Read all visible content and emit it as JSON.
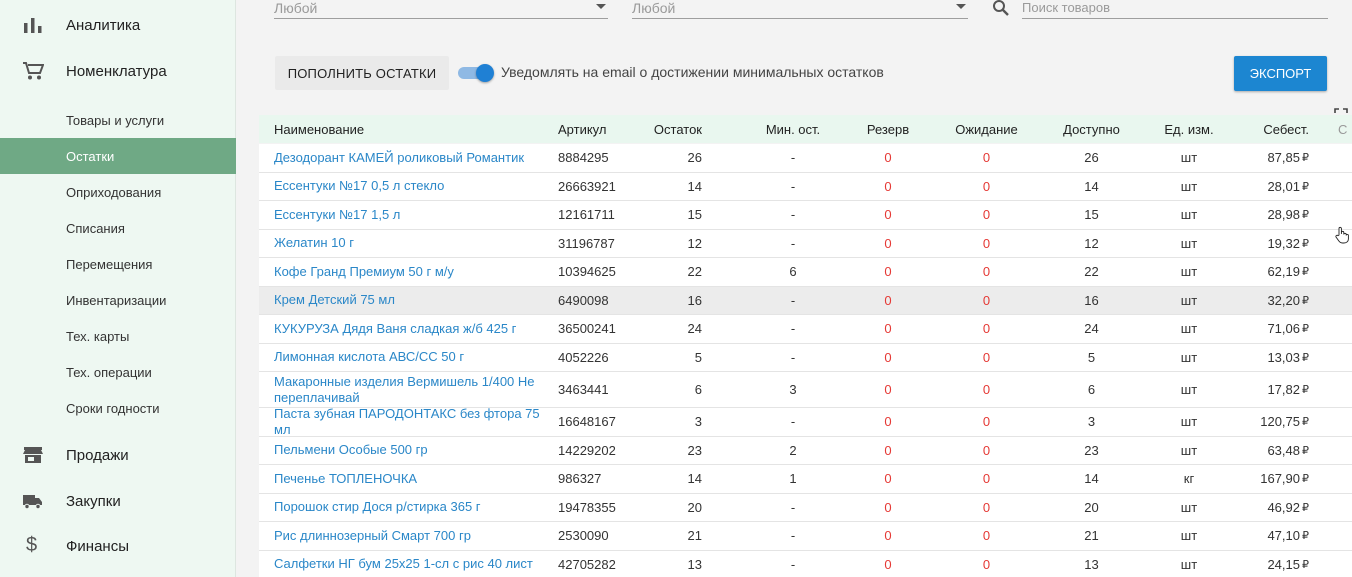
{
  "sidebar": {
    "main_items": [
      {
        "label": "Аналитика",
        "icon": "bar-chart-icon"
      },
      {
        "label": "Номенклатура",
        "icon": "cart-icon"
      },
      {
        "label": "Продажи",
        "icon": "store-icon"
      },
      {
        "label": "Закупки",
        "icon": "truck-icon"
      },
      {
        "label": "Финансы",
        "icon": "dollar-icon"
      }
    ],
    "sub_items": [
      {
        "label": "Товары и услуги"
      },
      {
        "label": "Остатки",
        "active": true
      },
      {
        "label": "Оприходования"
      },
      {
        "label": "Списания"
      },
      {
        "label": "Перемещения"
      },
      {
        "label": "Инвентаризации"
      },
      {
        "label": "Тех. карты"
      },
      {
        "label": "Тех. операции"
      },
      {
        "label": "Сроки годности"
      }
    ]
  },
  "filters": {
    "filter1_value": "Любой",
    "filter2_value": "Любой",
    "search_placeholder": "Поиск товаров"
  },
  "toolbar": {
    "restock_label": "ПОПОЛНИТЬ ОСТАТКИ",
    "notify_label": "Уведомлять на email о достижении минимальных остатков",
    "notify_enabled": true,
    "export_label": "ЭКСПОРТ"
  },
  "colors": {
    "accent": "#1c86d1",
    "active_nav": "#6fa985",
    "zero_value": "#e53935",
    "link": "#2a87c8"
  },
  "table": {
    "headers": [
      "Наименование",
      "Артикул",
      "Остаток",
      "Мин. ост.",
      "Резерв",
      "Ожидание",
      "Доступно",
      "Ед. изм.",
      "Себест."
    ],
    "currency": "₽",
    "rows": [
      {
        "name": "Дезодорант КАМЕЙ роликовый Романтик",
        "sku": "8884295",
        "stock": "26",
        "min": "-",
        "reserve": "0",
        "pending": "0",
        "available": "26",
        "unit": "шт",
        "cost": "87,85"
      },
      {
        "name": "Ессентуки №17 0,5 л стекло",
        "sku": "26663921",
        "stock": "14",
        "min": "-",
        "reserve": "0",
        "pending": "0",
        "available": "14",
        "unit": "шт",
        "cost": "28,01"
      },
      {
        "name": "Ессентуки №17 1,5 л",
        "sku": "12161711",
        "stock": "15",
        "min": "-",
        "reserve": "0",
        "pending": "0",
        "available": "15",
        "unit": "шт",
        "cost": "28,98"
      },
      {
        "name": "Желатин 10 г",
        "sku": "31196787",
        "stock": "12",
        "min": "-",
        "reserve": "0",
        "pending": "0",
        "available": "12",
        "unit": "шт",
        "cost": "19,32"
      },
      {
        "name": "Кофе Гранд Премиум 50 г м/у",
        "sku": "10394625",
        "stock": "22",
        "min": "6",
        "reserve": "0",
        "pending": "0",
        "available": "22",
        "unit": "шт",
        "cost": "62,19"
      },
      {
        "name": "Крем Детский 75 мл",
        "sku": "6490098",
        "stock": "16",
        "min": "-",
        "reserve": "0",
        "pending": "0",
        "available": "16",
        "unit": "шт",
        "cost": "32,20",
        "highlight": true
      },
      {
        "name": "КУКУРУЗА Дядя Ваня сладкая ж/б 425 г",
        "sku": "36500241",
        "stock": "24",
        "min": "-",
        "reserve": "0",
        "pending": "0",
        "available": "24",
        "unit": "шт",
        "cost": "71,06"
      },
      {
        "name": "Лимонная кислота АВС/СС 50 г",
        "sku": "4052226",
        "stock": "5",
        "min": "-",
        "reserve": "0",
        "pending": "0",
        "available": "5",
        "unit": "шт",
        "cost": "13,03"
      },
      {
        "name": "Макаронные изделия Вермишель 1/400 Не переплачивай",
        "sku": "3463441",
        "stock": "6",
        "min": "3",
        "reserve": "0",
        "pending": "0",
        "available": "6",
        "unit": "шт",
        "cost": "17,82",
        "tall": true
      },
      {
        "name": "Паста зубная ПАРОДОНТАКС без фтора 75 мл",
        "sku": "16648167",
        "stock": "3",
        "min": "-",
        "reserve": "0",
        "pending": "0",
        "available": "3",
        "unit": "шт",
        "cost": "120,75"
      },
      {
        "name": "Пельмени Особые 500 гр",
        "sku": "14229202",
        "stock": "23",
        "min": "2",
        "reserve": "0",
        "pending": "0",
        "available": "23",
        "unit": "шт",
        "cost": "63,48"
      },
      {
        "name": "Печенье ТОПЛЕНОЧКА",
        "sku": "986327",
        "stock": "14",
        "min": "1",
        "reserve": "0",
        "pending": "0",
        "available": "14",
        "unit": "кг",
        "cost": "167,90"
      },
      {
        "name": "Порошок стир Дося р/стирка 365 г",
        "sku": "19478355",
        "stock": "20",
        "min": "-",
        "reserve": "0",
        "pending": "0",
        "available": "20",
        "unit": "шт",
        "cost": "46,92"
      },
      {
        "name": "Рис длиннозерный Смарт 700 гр",
        "sku": "2530090",
        "stock": "21",
        "min": "-",
        "reserve": "0",
        "pending": "0",
        "available": "21",
        "unit": "шт",
        "cost": "47,10"
      },
      {
        "name": "Салфетки НГ бум 25х25 1-сл с рис 40 лист",
        "sku": "42705282",
        "stock": "13",
        "min": "-",
        "reserve": "0",
        "pending": "0",
        "available": "13",
        "unit": "шт",
        "cost": "24,15"
      }
    ]
  }
}
